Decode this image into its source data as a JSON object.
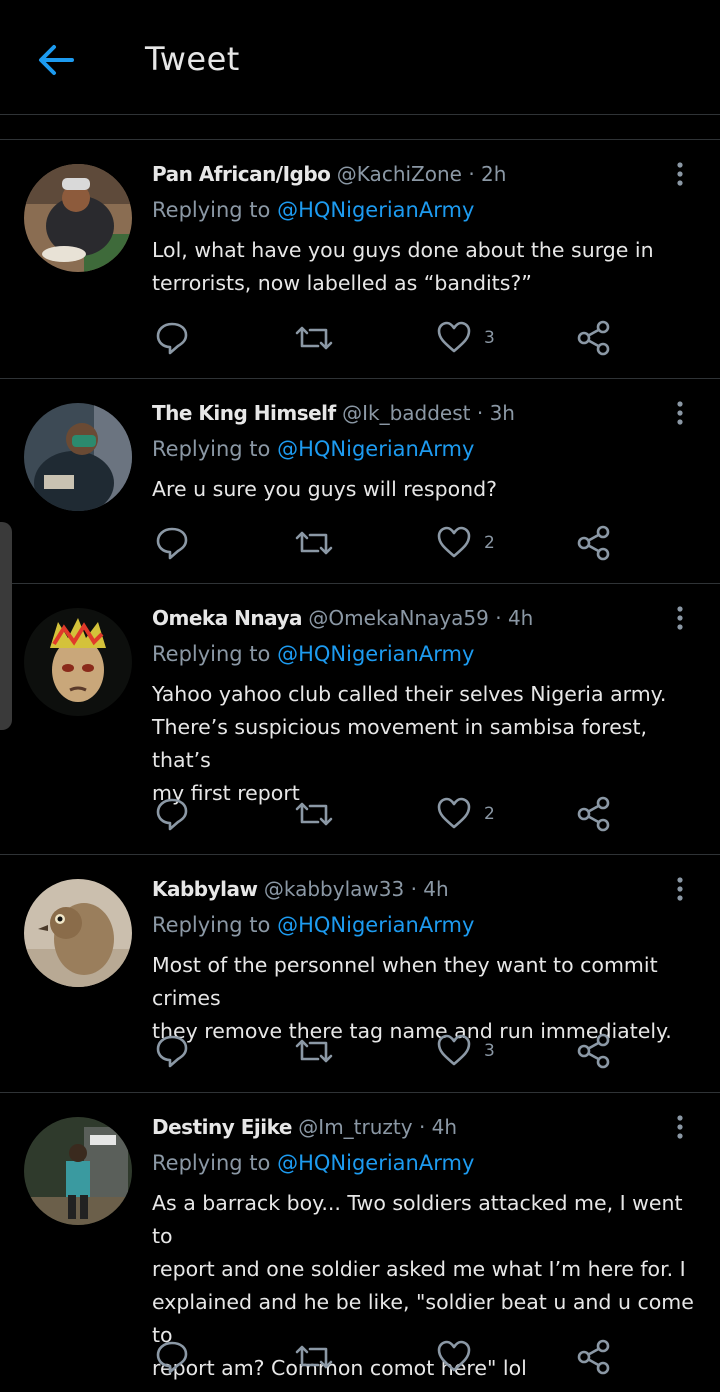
{
  "header": {
    "title": "Tweet"
  },
  "reply_prefix": "Replying to",
  "tweets": [
    {
      "name": "Pan African/Igbo",
      "handle": "@KachiZone",
      "time": "2h",
      "replying_to": "@HQNigerianArmy",
      "text_lines": [
        "Lol, what have you guys done about the surge in",
        "terrorists, now labelled as “bandits?”"
      ],
      "likes": "3"
    },
    {
      "name": "The King Himself",
      "handle": "@Ik_baddest",
      "time": "3h",
      "replying_to": "@HQNigerianArmy",
      "text_lines": [
        "Are u sure you guys will respond?"
      ],
      "likes": "2"
    },
    {
      "name": "Omeka Nnaya",
      "handle": "@OmekaNnaya59",
      "time": "4h",
      "replying_to": "@HQNigerianArmy",
      "text_lines": [
        "Yahoo yahoo club called their selves Nigeria army.",
        "There’s suspicious movement in sambisa forest, that’s",
        "my first report"
      ],
      "likes": "2"
    },
    {
      "name": "Kabbylaw",
      "handle": "@kabbylaw33",
      "time": "4h",
      "replying_to": "@HQNigerianArmy",
      "text_lines": [
        "Most of the personnel when they want to commit crimes",
        "they remove there tag name and run immediately."
      ],
      "likes": "3"
    },
    {
      "name": "Destiny Ejike",
      "handle": "@Im_truzty",
      "time": "4h",
      "replying_to": "@HQNigerianArmy",
      "text_lines": [
        "As a barrack boy... Two soldiers attacked me, I went to",
        "report and one soldier asked me what I’m here for. I",
        "explained and he be like, \"soldier beat u and u come to",
        "report am? Common comot here\" lol"
      ],
      "likes": ""
    }
  ]
}
